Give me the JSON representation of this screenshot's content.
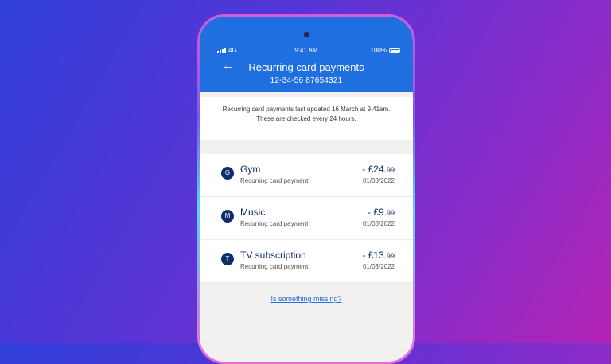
{
  "status_bar": {
    "network": "4G",
    "time": "9:41 AM",
    "battery": "100%"
  },
  "header": {
    "back_icon": "arrow-left-icon",
    "title": "Recurring card payments",
    "account": "12-34-56  87654321"
  },
  "notice": {
    "line1": "Recurring card payments last updated 16 March at 9.41am.",
    "line2": "These are checked every 24 hours."
  },
  "payments": [
    {
      "initial": "G",
      "name": "Gym",
      "description": "Recurring card payment",
      "amount_main": "- £24.",
      "amount_pence": "99",
      "date": "01/03/2022"
    },
    {
      "initial": "M",
      "name": "Music",
      "description": "Recurring card payment",
      "amount_main": "- £9.",
      "amount_pence": "99",
      "date": "01/03/2022"
    },
    {
      "initial": "T",
      "name": "TV subscription",
      "description": "Recurring card payment",
      "amount_main": "- £13.",
      "amount_pence": "99",
      "date": "01/03/2022"
    }
  ],
  "footer": {
    "missing_link": "Is something missing?"
  },
  "colors": {
    "header_blue": "#1f6fe0",
    "navy": "#0f2d6b"
  }
}
